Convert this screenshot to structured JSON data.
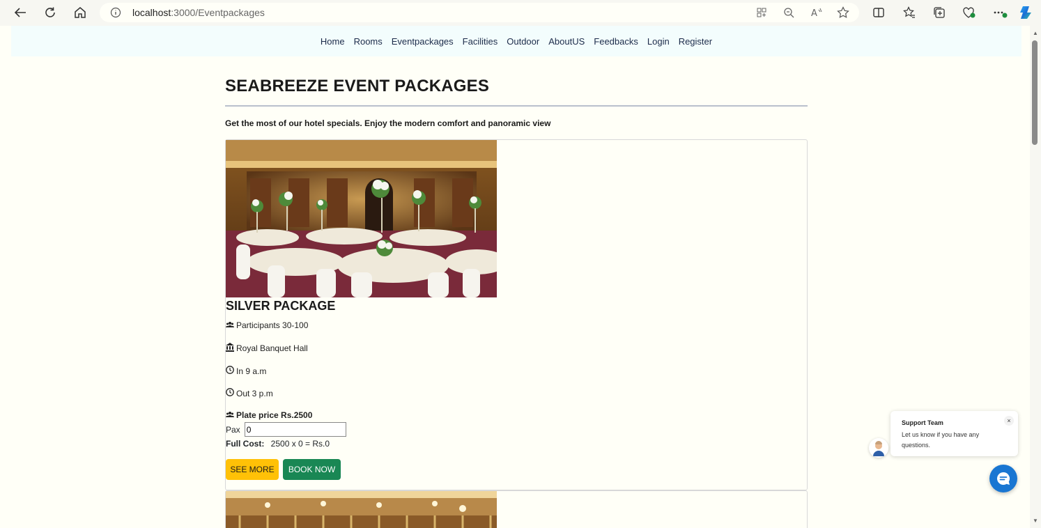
{
  "browser": {
    "url_host": "localhost",
    "url_path": ":3000/Eventpackages"
  },
  "nav": {
    "items": [
      "Home",
      "Rooms",
      "Eventpackages",
      "Facilities",
      "Outdoor",
      "AboutUS",
      "Feedbacks",
      "Login",
      "Register"
    ]
  },
  "page": {
    "title": "SEABREEZE EVENT PACKAGES",
    "subtitle": "Get the most of our hotel specials. Enjoy the modern comfort and panoramic view"
  },
  "package": {
    "title": "SILVER PACKAGE",
    "participants": "Participants 30-100",
    "hall": "Royal Banquet Hall",
    "time_in": "In 9 a.m",
    "time_out": "Out 3 p.m",
    "plate_price": "Plate price Rs.2500",
    "pax_label": "Pax",
    "pax_value": "0",
    "full_cost_label": "Full Cost:",
    "full_cost_value": "2500 x 0 = Rs.0",
    "see_more": "SEE MORE",
    "book_now": "BOOK NOW"
  },
  "chat": {
    "team": "Support Team",
    "message": "Let us know if you have any questions.",
    "close": "×"
  },
  "colors": {
    "see_more": "#ffc107",
    "book_now": "#198754",
    "chat": "#1976d2"
  }
}
